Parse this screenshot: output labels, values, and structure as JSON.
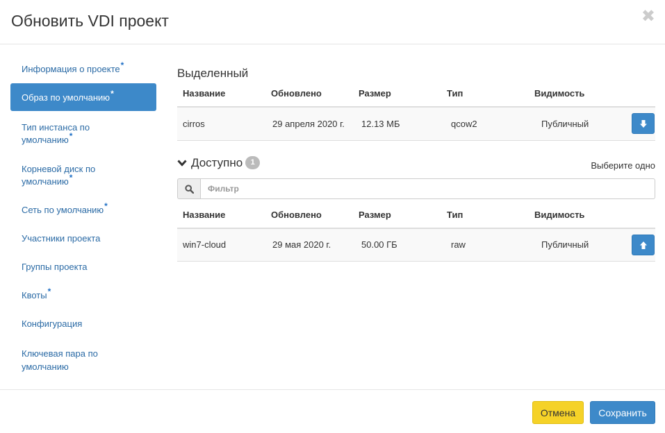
{
  "modal": {
    "title": "Обновить VDI проект",
    "close_symbol": "✖"
  },
  "sidebar": {
    "items": [
      {
        "label": "Информация о проекте",
        "required": "*",
        "active": false
      },
      {
        "label": "Образ по умолчанию",
        "required": "*",
        "active": true
      },
      {
        "label": "Тип инстанса по умолчанию",
        "required": "*",
        "active": false
      },
      {
        "label": "Корневой диск по умолчанию",
        "required": "*",
        "active": false
      },
      {
        "label": "Сеть по умолчанию",
        "required": "*",
        "active": false
      },
      {
        "label": "Участники проекта",
        "required": "",
        "active": false
      },
      {
        "label": "Группы проекта",
        "required": "",
        "active": false
      },
      {
        "label": "Квоты",
        "required": "*",
        "active": false
      },
      {
        "label": "Конфигурация",
        "required": "",
        "active": false
      },
      {
        "label": "Ключевая пара по умолчанию",
        "required": "",
        "active": false
      }
    ]
  },
  "allocated": {
    "title": "Выделенный",
    "columns": [
      "Название",
      "Обновлено",
      "Размер",
      "Тип",
      "Видимость"
    ],
    "rows": [
      {
        "name": "cirros",
        "updated": "29 апреля 2020 г.",
        "size": "12.13 МБ",
        "type": "qcow2",
        "visibility": "Публичный",
        "action_icon": "arrow-down-icon"
      }
    ]
  },
  "available": {
    "title": "Доступно",
    "count": "1",
    "hint": "Выберите одно",
    "filter_placeholder": "Фильтр",
    "filter_value": "",
    "columns": [
      "Название",
      "Обновлено",
      "Размер",
      "Тип",
      "Видимость"
    ],
    "rows": [
      {
        "name": "win7-cloud",
        "updated": "29 мая 2020 г.",
        "size": "50.00 ГБ",
        "type": "raw",
        "visibility": "Публичный",
        "action_icon": "arrow-up-icon"
      }
    ]
  },
  "footer": {
    "cancel_label": "Отмена",
    "save_label": "Сохранить"
  },
  "colors": {
    "primary": "#3d89c9",
    "warning": "#f5d228",
    "link": "#2a6aa5",
    "badge": "#bbbbbb"
  }
}
